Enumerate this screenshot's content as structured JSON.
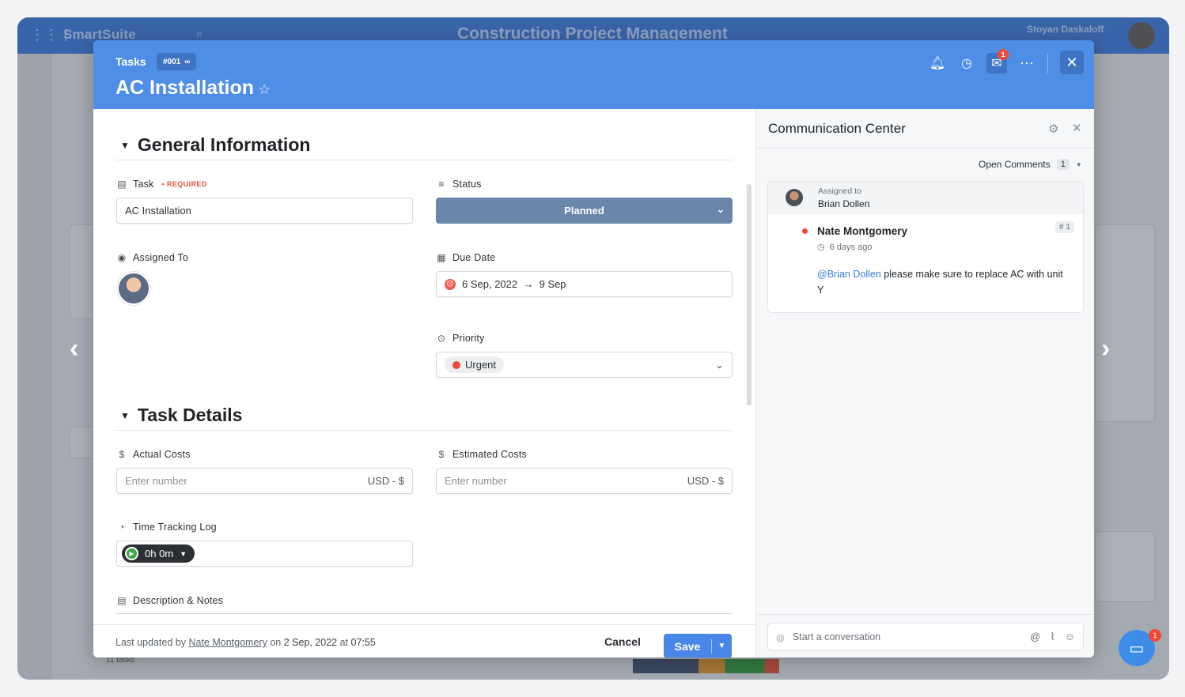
{
  "background": {
    "brand": "SmartSuite",
    "workspace_title": "Construction Project Management",
    "user_name": "Stoyan Daskaloff",
    "tasks_count": "11 tasks"
  },
  "modal": {
    "breadcrumb": "Tasks",
    "record_id": "#001",
    "title": "AC Installation",
    "notification_count": "1",
    "sections": {
      "general": "General Information",
      "details": "Task Details"
    },
    "fields": {
      "task": {
        "label": "Task",
        "required": "• REQUIRED",
        "value": "AC Installation"
      },
      "status": {
        "label": "Status",
        "value": "Planned"
      },
      "assigned_to": {
        "label": "Assigned To"
      },
      "due_date": {
        "label": "Due Date",
        "value": "6 Sep, 2022  →  9 Sep"
      },
      "priority": {
        "label": "Priority",
        "value": "Urgent"
      },
      "actual_costs": {
        "label": "Actual Costs",
        "placeholder": "Enter number",
        "currency": "USD - $"
      },
      "estimated_costs": {
        "label": "Estimated Costs",
        "placeholder": "Enter number",
        "currency": "USD - $"
      },
      "time_tracking": {
        "label": "Time Tracking Log",
        "value": "0h 0m"
      },
      "description": {
        "label": "Description & Notes"
      }
    },
    "footer": {
      "last_updated_prefix": "Last updated",
      "by": "by",
      "user": "Nate Montgomery",
      "on": "on",
      "date": "2 Sep, 2022",
      "at": "at",
      "time": "07:55",
      "cancel": "Cancel",
      "save": "Save"
    }
  },
  "comm": {
    "title": "Communication Center",
    "open_comments_label": "Open Comments",
    "open_comments_count": "1",
    "assigned_label": "Assigned to",
    "assigned_name": "Brian Dollen",
    "comment": {
      "author": "Nate Montgomery",
      "time": "6 days ago",
      "number": "# 1",
      "mention": "@Brian Dollen",
      "text": " please make sure to replace AC with unit Y"
    },
    "compose_placeholder": "Start a conversation"
  },
  "help_badge": "1",
  "colors": {
    "header_blue": "#4f8ee6",
    "status_planned": "#6a87ab",
    "urgent": "#ee4a3a",
    "save": "#4a86e8"
  }
}
